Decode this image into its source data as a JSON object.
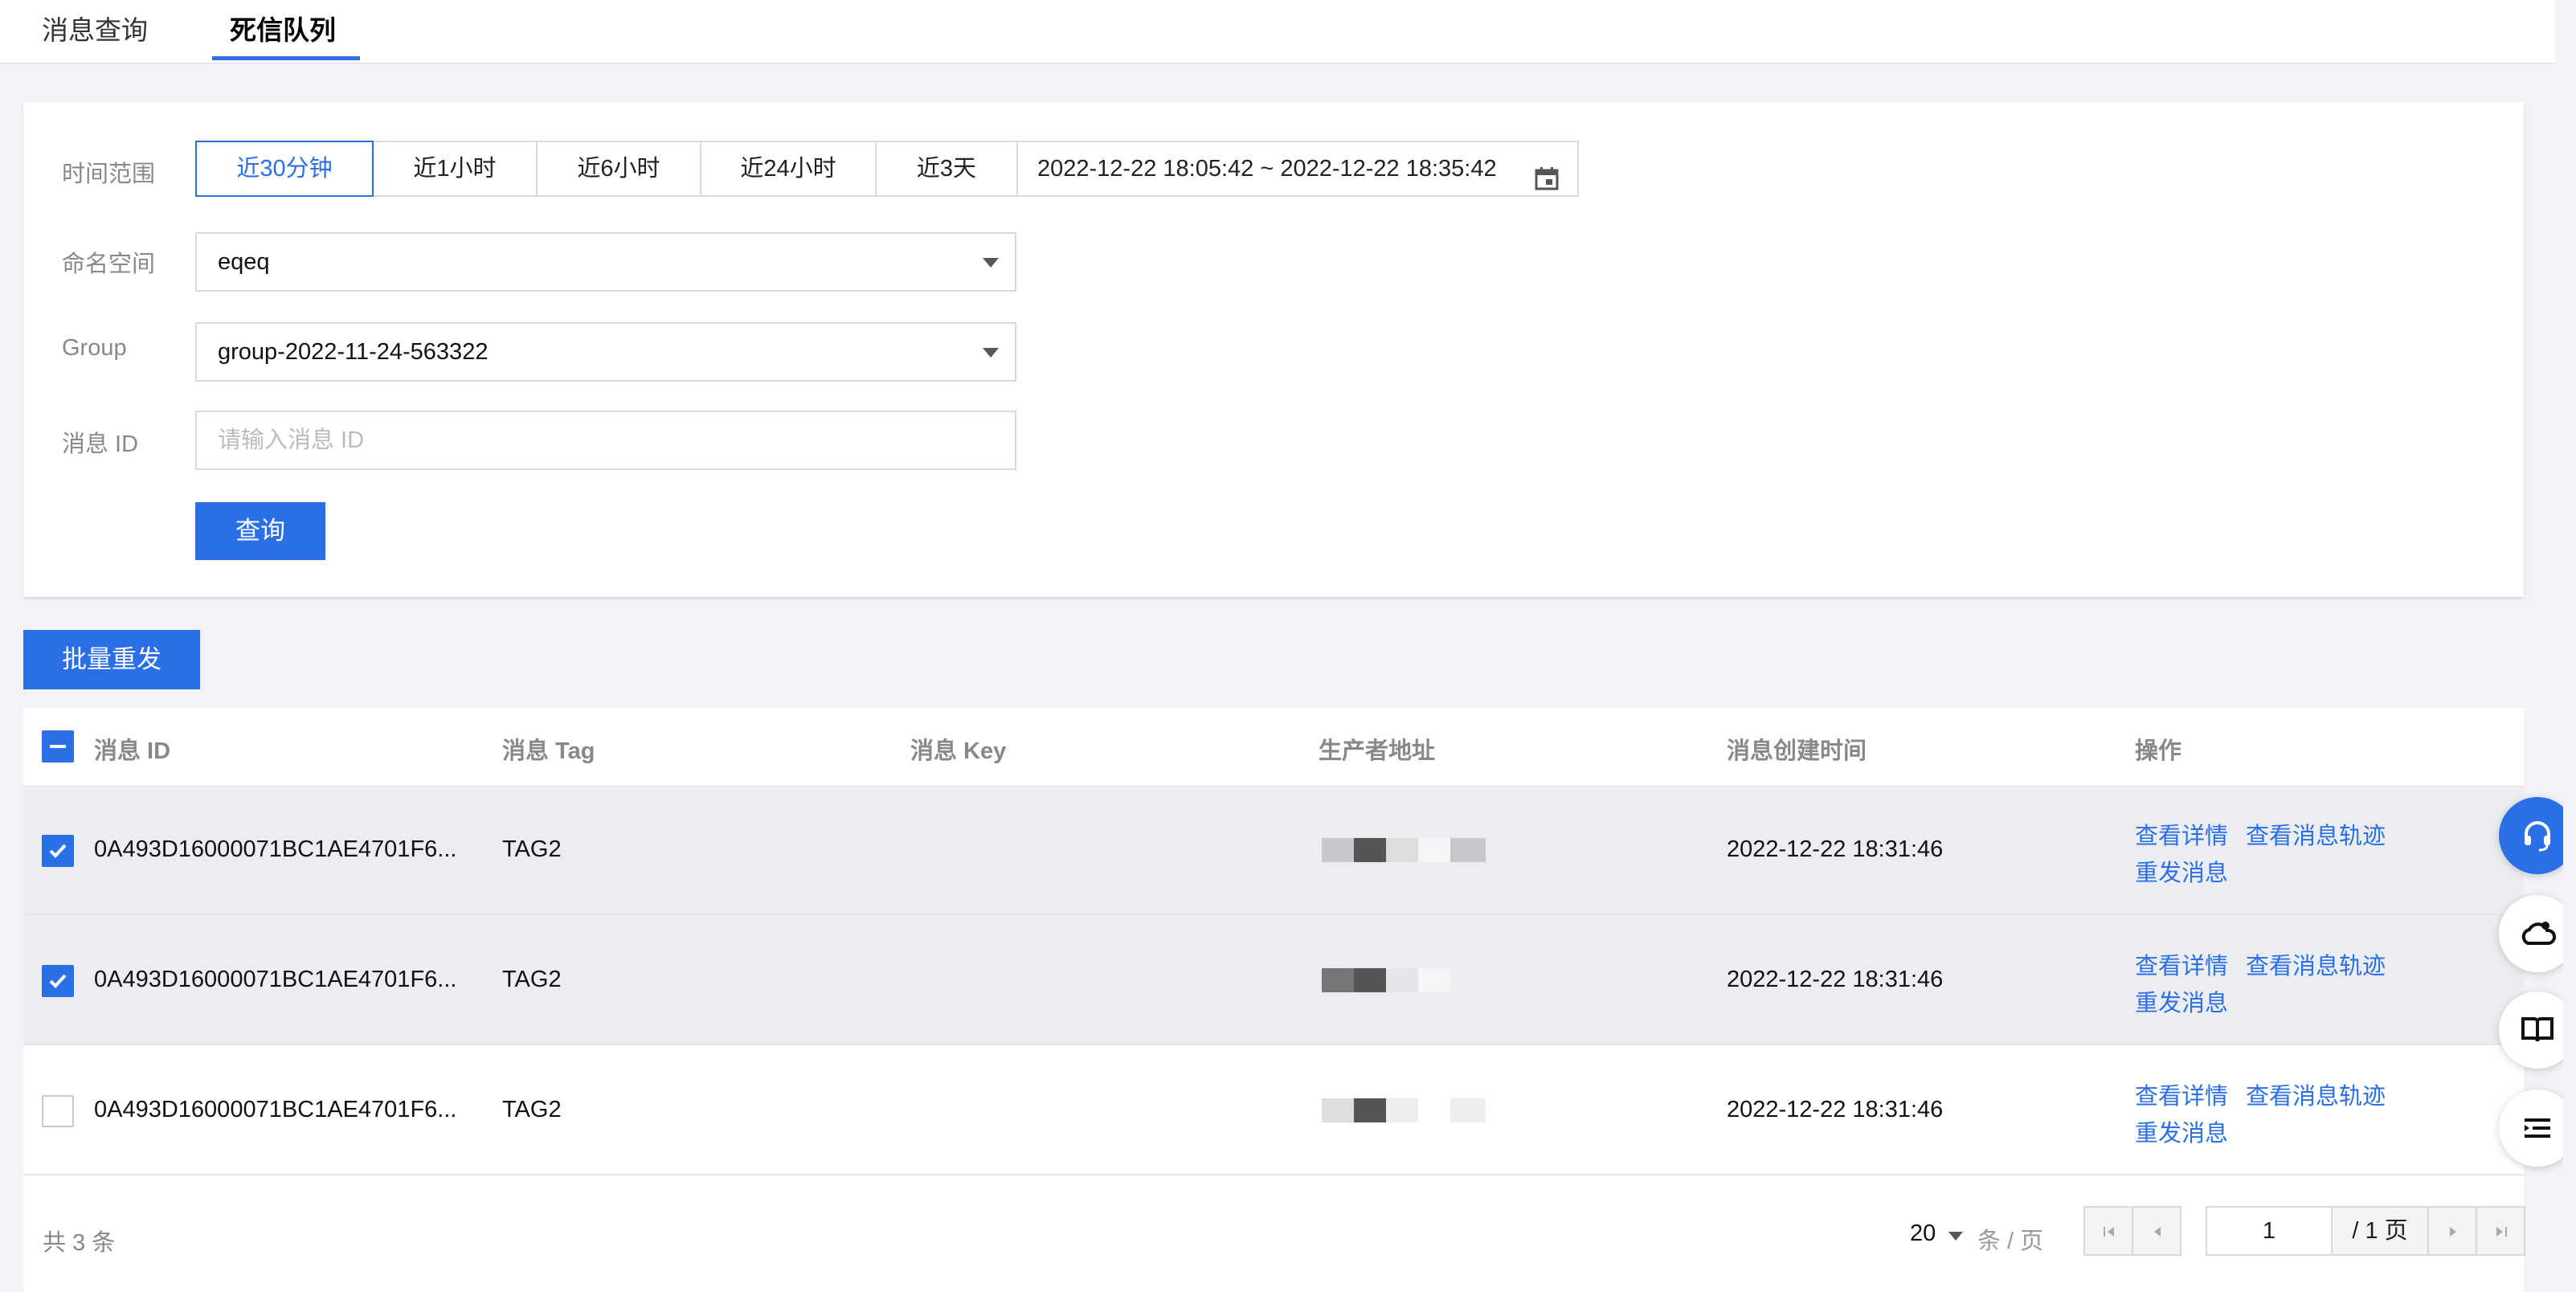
{
  "tabs": [
    {
      "label": "消息查询",
      "active": false
    },
    {
      "label": "死信队列",
      "active": true
    }
  ],
  "filters": {
    "time_label": "时间范围",
    "time_options": [
      "近30分钟",
      "近1小时",
      "近6小时",
      "近24小时",
      "近3天"
    ],
    "time_selected": "近30分钟",
    "time_range_value": "2022-12-22 18:05:42 ~ 2022-12-22 18:35:42",
    "namespace_label": "命名空间",
    "namespace_value": "eqeq",
    "group_label": "Group",
    "group_value": "group-2022-11-24-563322",
    "msgid_label": "消息 ID",
    "msgid_placeholder": "请输入消息 ID",
    "query_button": "查询"
  },
  "batch_resend_button": "批量重发",
  "table": {
    "columns": [
      "消息 ID",
      "消息 Tag",
      "消息 Key",
      "生产者地址",
      "消息创建时间",
      "操作"
    ],
    "rows": [
      {
        "checked": true,
        "id": "0A493D16000071BC1AE4701F6...",
        "tag": "TAG2",
        "key": "",
        "producer": "(obscured)",
        "created": "2022-12-22 18:31:46"
      },
      {
        "checked": true,
        "id": "0A493D16000071BC1AE4701F6...",
        "tag": "TAG2",
        "key": "",
        "producer": "(obscured)",
        "created": "2022-12-22 18:31:46"
      },
      {
        "checked": false,
        "id": "0A493D16000071BC1AE4701F6...",
        "tag": "TAG2",
        "key": "",
        "producer": "(obscured)",
        "created": "2022-12-22 18:31:46"
      }
    ],
    "actions": {
      "detail": "查看详情",
      "trace": "查看消息轨迹",
      "resend": "重发消息"
    }
  },
  "pagination": {
    "total_text": "共 3 条",
    "page_size": "20",
    "page_size_unit": "条 / 页",
    "current_page": "1",
    "total_pages_text": "/ 1 页"
  },
  "float_tools": [
    "headset-icon",
    "cloud-bell-icon",
    "book-icon",
    "outline-icon"
  ],
  "colors": {
    "accent": "#2b6fe6",
    "background": "#f2f3f6",
    "selected_row": "#ebedf1"
  }
}
